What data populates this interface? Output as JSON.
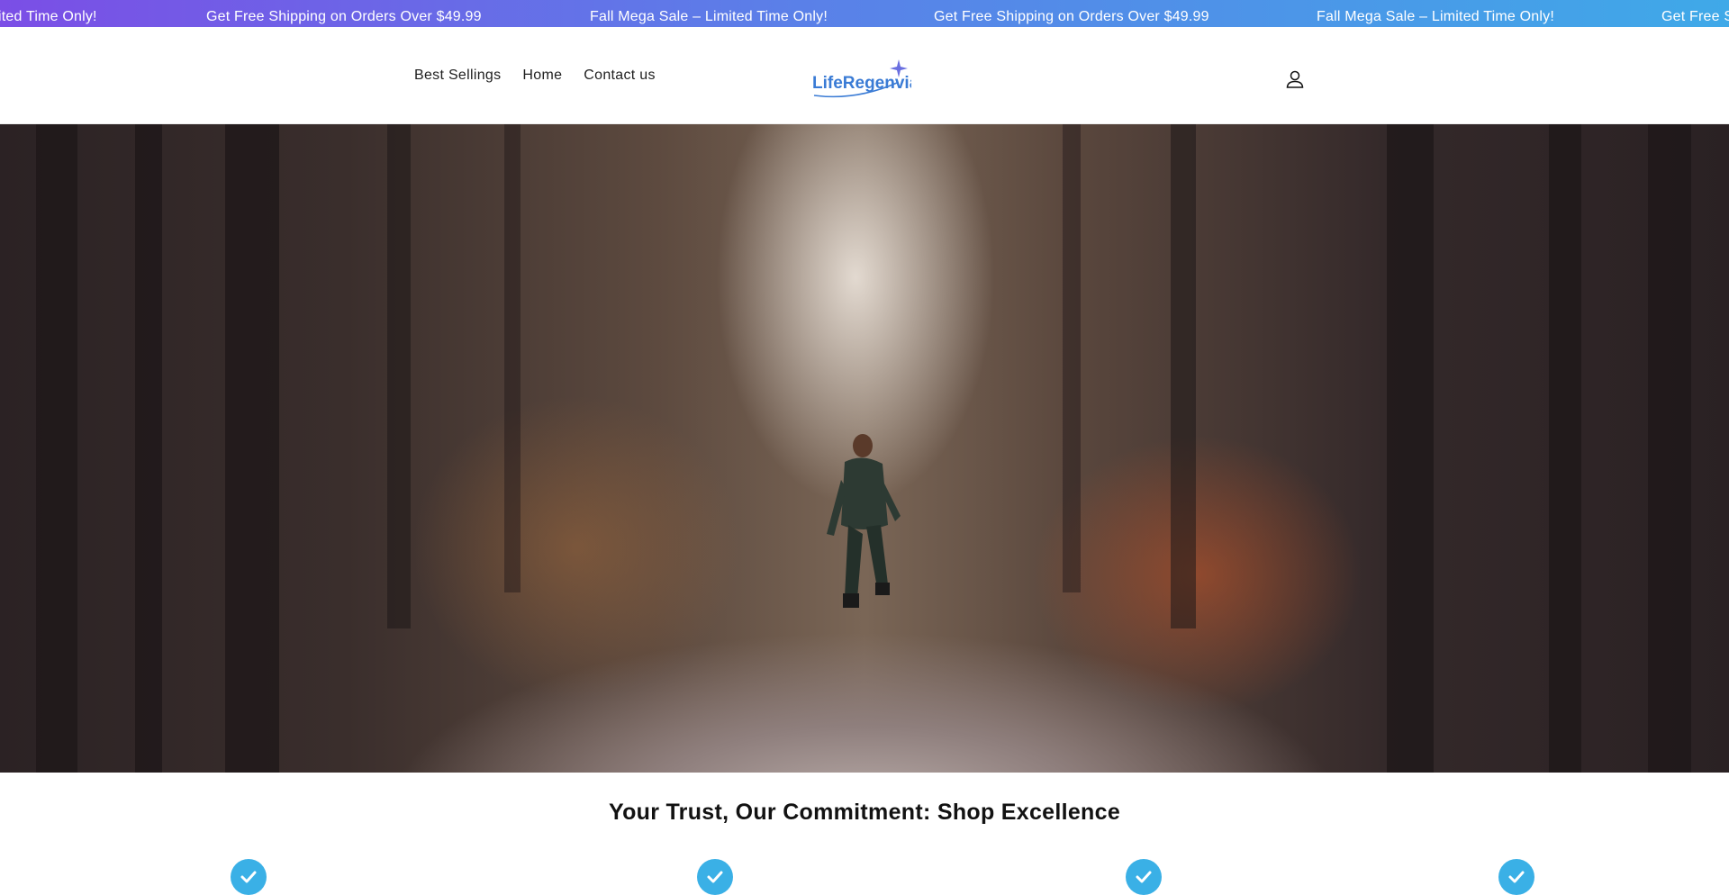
{
  "announcement": {
    "messages": [
      "ited Time Only!",
      "Get Free Shipping on Orders Over $49.99",
      "Fall Mega Sale – Limited Time Only!",
      "Get Free Shipping on Orders Over $49.99",
      "Fall Mega Sale – Limited Time Only!",
      "Get Free S"
    ]
  },
  "header": {
    "nav": [
      {
        "label": "Best Sellings"
      },
      {
        "label": "Home"
      },
      {
        "label": "Contact us"
      }
    ],
    "logo_text": "LifeRegenvia",
    "account_icon": "account-icon"
  },
  "hero": {
    "image_alt": "Person running on a forest gravel road"
  },
  "trust": {
    "title": "Your Trust, Our Commitment: Shop Excellence",
    "icon": "check-icon",
    "icon_color": "#3ab0e6"
  },
  "colors": {
    "announcement_start": "#7b4ee6",
    "announcement_end": "#3fa9e8",
    "logo_blue": "#3a7bd5",
    "logo_purple": "#8a5be8"
  }
}
